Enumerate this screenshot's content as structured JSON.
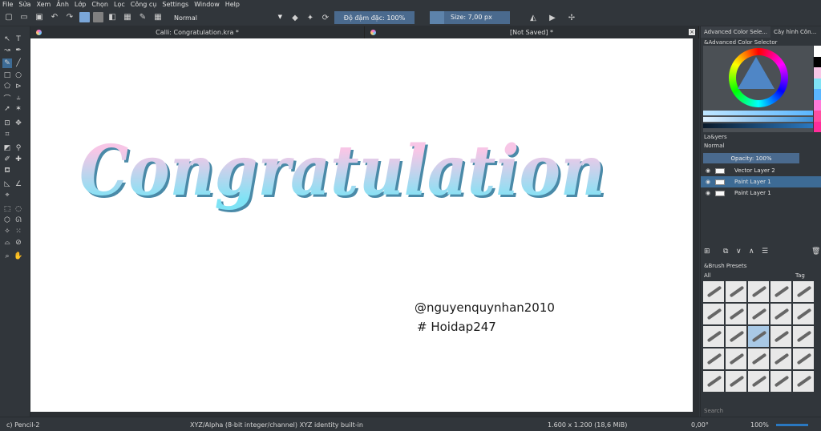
{
  "menubar": {
    "items": [
      "File",
      "Sửa",
      "Xem",
      "Ảnh",
      "Lớp",
      "Chọn",
      "Lọc",
      "Công cụ",
      "Settings",
      "Window",
      "Help"
    ]
  },
  "toolbar": {
    "blend_mode": "Normal",
    "opacity_label": "Độ đậm đặc: 100%",
    "size_label": "Size: 7,00 px",
    "fg_color": "#7aa6d8",
    "bg_color": "#808080"
  },
  "tabs": [
    {
      "title": "Calli: Congratulation.kra *"
    },
    {
      "title": "[Not Saved]  *"
    }
  ],
  "canvas": {
    "artwork_text": "Congratulation",
    "gradient_top": "#f7c6e6",
    "gradient_bottom": "#7fe3f5",
    "credit_line1": "@nguyenquynhan2010",
    "credit_line2": "# Hoidap247"
  },
  "dock": {
    "tab1": "Advanced Color Sele...",
    "tab2": "Cây hình Côn...",
    "color_title": "&Advanced Color Selector",
    "layers_title": "La&yers",
    "layers_blend": "Normal",
    "layers_opacity": "Opacity: 100%",
    "layers": [
      {
        "name": "Vector Layer 2",
        "selected": false
      },
      {
        "name": "Paint Layer 1",
        "selected": true
      },
      {
        "name": "Paint Layer 1",
        "selected": false
      }
    ],
    "presets_title": "&Brush Presets",
    "presets_filter": "All",
    "presets_tag": "Tag",
    "presets_search": "Search"
  },
  "status": {
    "brush": "c) Pencil-2",
    "colorspace": "XYZ/Alpha (8-bit integer/channel)  XYZ identity built-in",
    "dimensions": "1.600 x 1.200 (18,6 MiB)",
    "rotation": "0,00°",
    "zoom": "100%"
  }
}
